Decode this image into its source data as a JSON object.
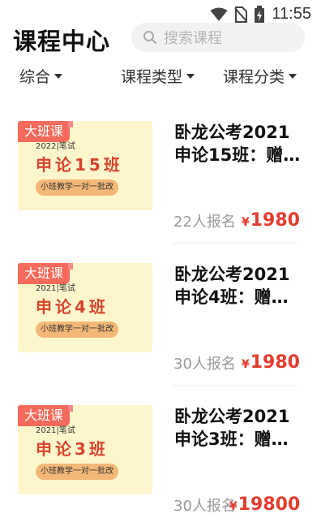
{
  "status": {
    "time": "11:55"
  },
  "header": {
    "title": "课程中心",
    "search_placeholder": "搜索课程"
  },
  "filters": [
    {
      "label": "综合"
    },
    {
      "label": "课程类型"
    },
    {
      "label": "课程分类"
    }
  ],
  "courses": [
    {
      "tag": "大班课",
      "thumb_sub": "2022|笔试",
      "thumb_name": "申论15班",
      "thumb_pill": "小班教学一对一批改",
      "title_line1": "卧龙公考2021",
      "title_line2": "申论15班：赠…",
      "enroll": "22人报名",
      "currency": "¥",
      "price": "1980"
    },
    {
      "tag": "大班课",
      "thumb_sub": "2021|笔试",
      "thumb_name": "申论4班",
      "thumb_pill": "小班教学一对一批改",
      "title_line1": "卧龙公考2021",
      "title_line2": "申论4班：赠…",
      "enroll": "30人报名",
      "currency": "¥",
      "price": "1980"
    },
    {
      "tag": "大班课",
      "thumb_sub": "2021|笔试",
      "thumb_name": "申论3班",
      "thumb_pill": "小班教学一对一批改",
      "title_line1": "卧龙公考2021",
      "title_line2": "申论3班：赠…",
      "enroll": "30人报名",
      "currency": "¥",
      "price": "19800"
    }
  ],
  "colors": {
    "accent": "#e23c2e",
    "tag": "#f56a5a",
    "thumb_bg": "#fdf6cc"
  }
}
